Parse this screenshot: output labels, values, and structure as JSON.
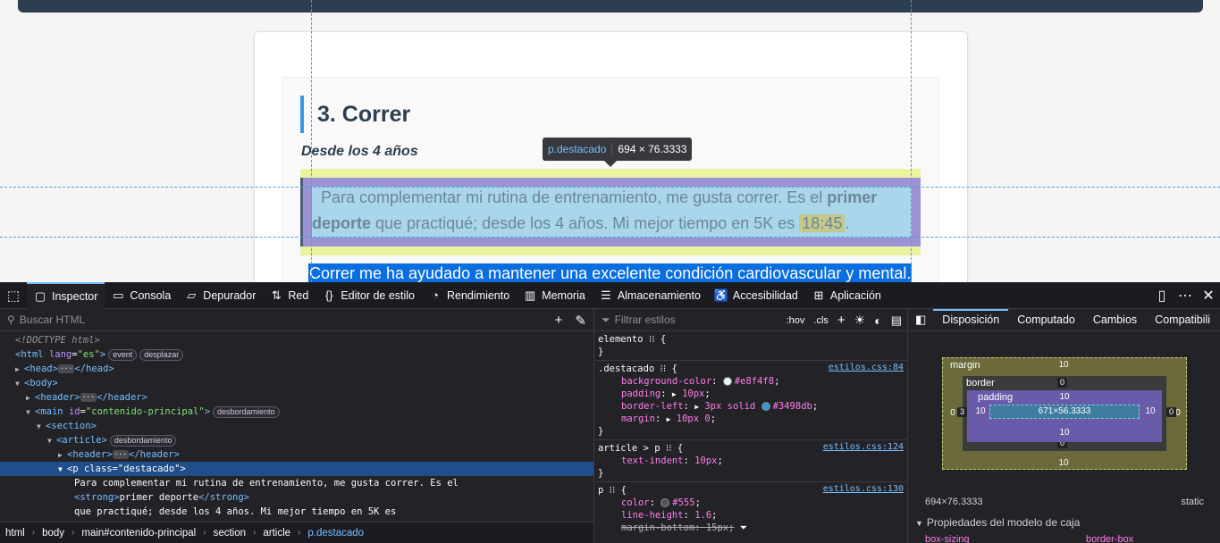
{
  "page": {
    "heading": "3. Correr",
    "subtitle": "Desde los 4 años",
    "para_before": "Para complementar mi rutina de entrenamiento, me gusta correr. Es el ",
    "para_strong": "primer deporte",
    "para_middle": " que practiqué; desde los 4 años. Mi mejor tiempo en 5K es ",
    "para_time": "18:45",
    "para_end": ".",
    "selected_text": "Correr me ha ayudado a mantener una excelente condición cardiovascular y mental.",
    "tooltip_tag": "p.destacado",
    "tooltip_size": "694 × 76.3333"
  },
  "toolbar": {
    "tabs": [
      {
        "icon": "inspector-icon",
        "label": "Inspector"
      },
      {
        "icon": "console-icon",
        "label": "Consola"
      },
      {
        "icon": "debugger-icon",
        "label": "Depurador"
      },
      {
        "icon": "network-icon",
        "label": "Red"
      },
      {
        "icon": "style-editor-icon",
        "label": "Editor de estilo"
      },
      {
        "icon": "performance-icon",
        "label": "Rendimiento"
      },
      {
        "icon": "memory-icon",
        "label": "Memoria"
      },
      {
        "icon": "storage-icon",
        "label": "Almacenamiento"
      },
      {
        "icon": "accessibility-icon",
        "label": "Accesibilidad"
      },
      {
        "icon": "application-icon",
        "label": "Aplicación"
      }
    ]
  },
  "html_pane": {
    "search_placeholder": "Buscar HTML",
    "doctype": "<!DOCTYPE html>",
    "html_lang": "\"es\"",
    "badge_event": "event",
    "badge_scroll": "desplazar",
    "badge_overflow": "desbordamiento",
    "main_id": "\"contenido-principal\"",
    "p_class": "\"destacado\"",
    "text_line1": "Para complementar mi rutina de entrenamiento, me gusta correr. Es el",
    "strong_text": "primer deporte",
    "text_line3": "que practiqué; desde los 4 años. Mi mejor tiempo en 5K es"
  },
  "breadcrumbs": [
    "html",
    "body",
    "main#contenido-principal",
    "section",
    "article",
    "p.destacado"
  ],
  "rules_pane": {
    "filter_placeholder": "Filtrar estilos",
    "hov": ":hov",
    "cls": ".cls",
    "rules": [
      {
        "selector": "elemento",
        "source": ""
      },
      {
        "selector": ".destacado",
        "source": "estilos.css:84"
      },
      {
        "selector": "article > p",
        "source": "estilos.css:124"
      },
      {
        "selector": "p",
        "source": "estilos.css:130"
      }
    ],
    "destacado_bg": "#e8f4f8",
    "destacado_padding": "10px",
    "destacado_border": "3px solid",
    "destacado_border_color": "#3498db",
    "destacado_margin": "10px 0",
    "text_indent": "10px",
    "p_color": "#555",
    "p_line_height": "1.6",
    "p_margin_bottom": "15px"
  },
  "layout_pane": {
    "tabs": [
      "Disposición",
      "Computado",
      "Cambios",
      "Compatibili"
    ],
    "margin_label": "margin",
    "border_label": "border",
    "padding_label": "padding",
    "margin_top": "10",
    "margin_bottom": "10",
    "margin_left": "0",
    "margin_right": "0",
    "border_top": "0",
    "border_bottom": "0",
    "border_left": "3",
    "border_right": "0",
    "padding_top": "10",
    "padding_bottom": "10",
    "padding_left": "10",
    "padding_right": "10",
    "content_size": "671×56.3333",
    "element_size": "694×76.3333",
    "position": "static",
    "section_title": "Propiedades del modelo de caja",
    "prop_name": "box-sizing",
    "prop_value": "border-box"
  },
  "colors": {
    "accent": "#3498db",
    "devtools_bg": "#232327",
    "selection": "#204e8a"
  }
}
